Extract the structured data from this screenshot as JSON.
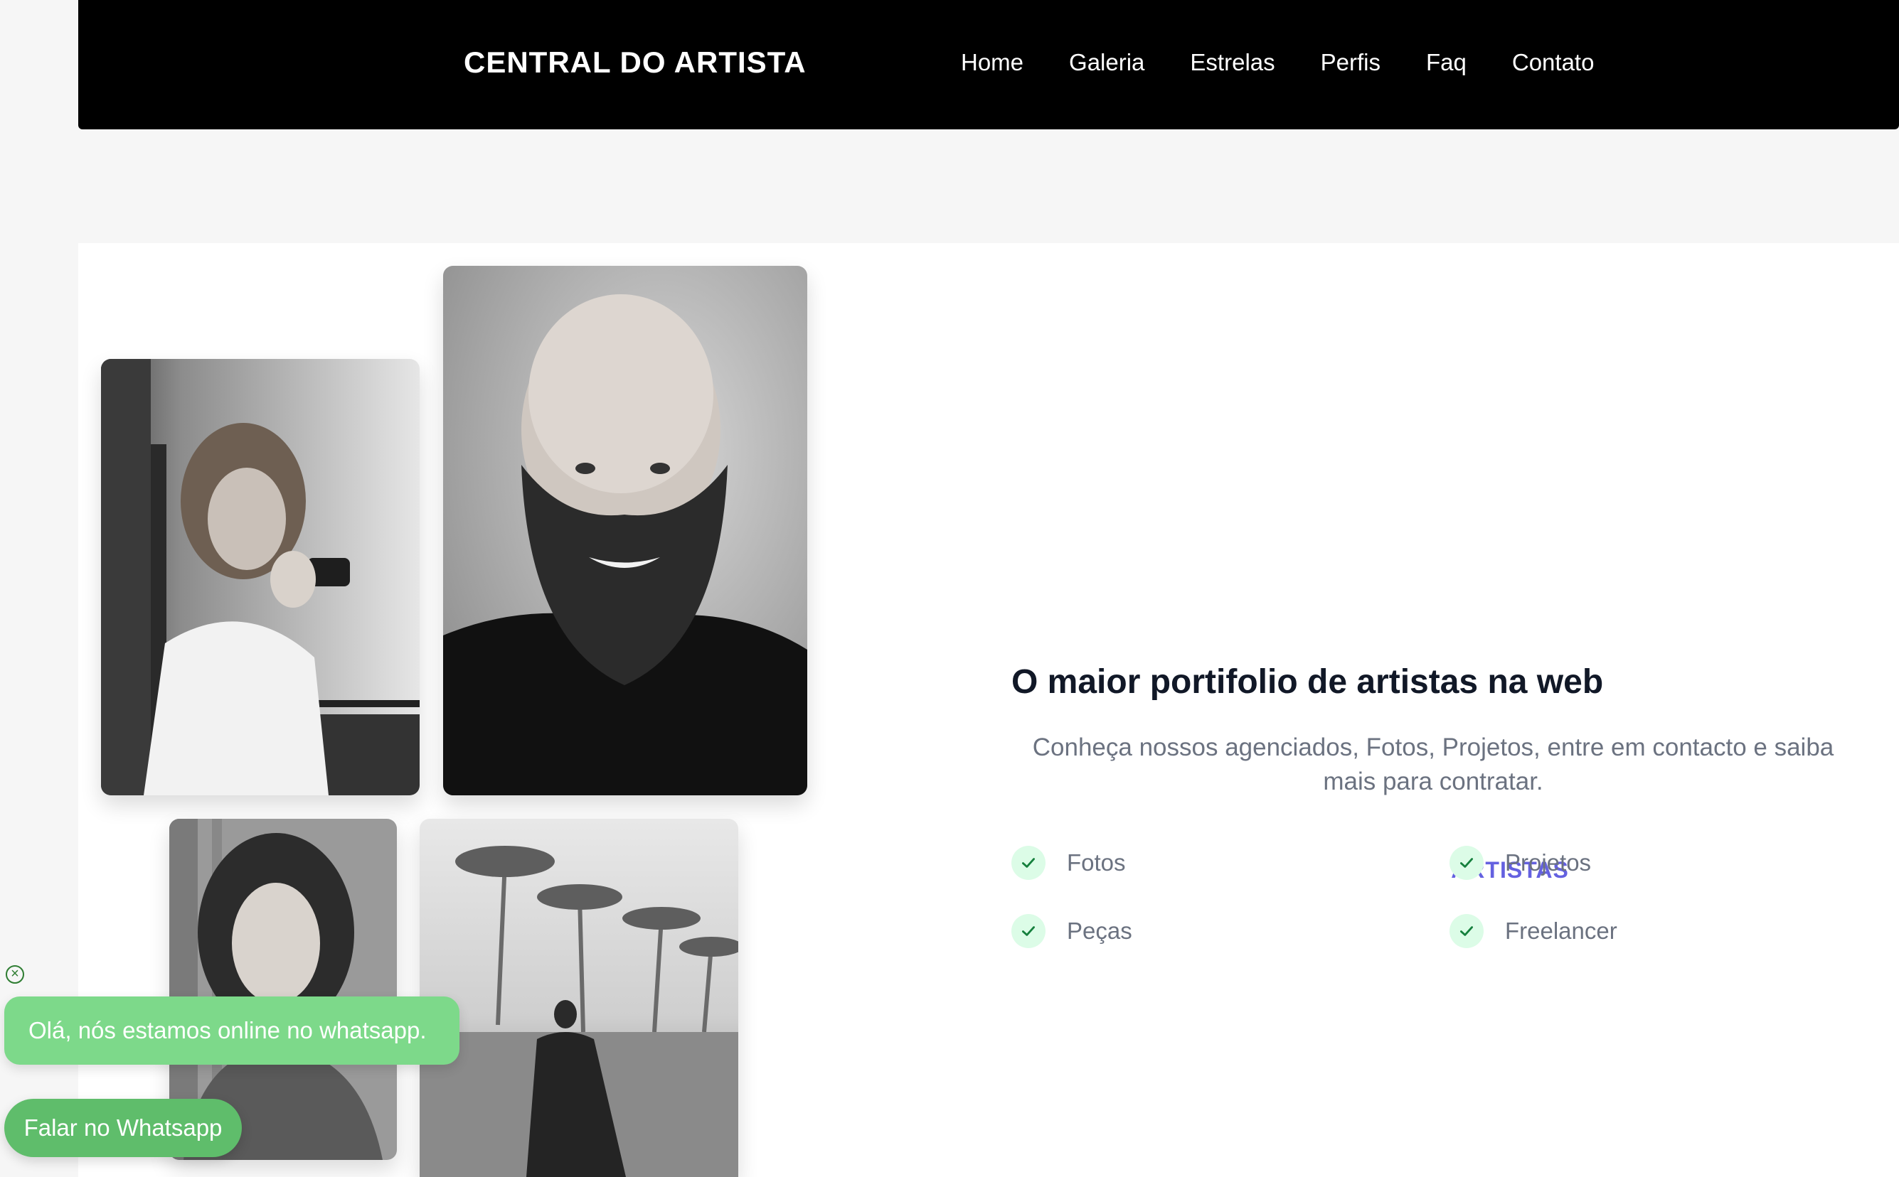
{
  "header": {
    "brand": "CENTRAL DO ARTISTA",
    "nav": [
      "Home",
      "Galeria",
      "Estrelas",
      "Perfis",
      "Faq",
      "Contato"
    ]
  },
  "hero": {
    "eyebrow": "ARTISTAS",
    "title": "O maior portifolio de artistas na web",
    "description": "Conheça nossos agenciados, Fotos, Projetos, entre em contacto e saiba mais para contratar.",
    "features": [
      "Fotos",
      "Projetos",
      "Peças",
      "Freelancer"
    ]
  },
  "whatsapp": {
    "message": "Olá, nós estamos online no whatsapp.",
    "button_label": "Falar no Whatsapp",
    "close_glyph": "×"
  },
  "colors": {
    "accent": "#6461e0",
    "heading": "#111827",
    "check_bg": "#dcfce7",
    "check_icon": "#15803d",
    "whatsapp_bubble": "#7dd98a",
    "whatsapp_button": "#5fbd6b"
  }
}
